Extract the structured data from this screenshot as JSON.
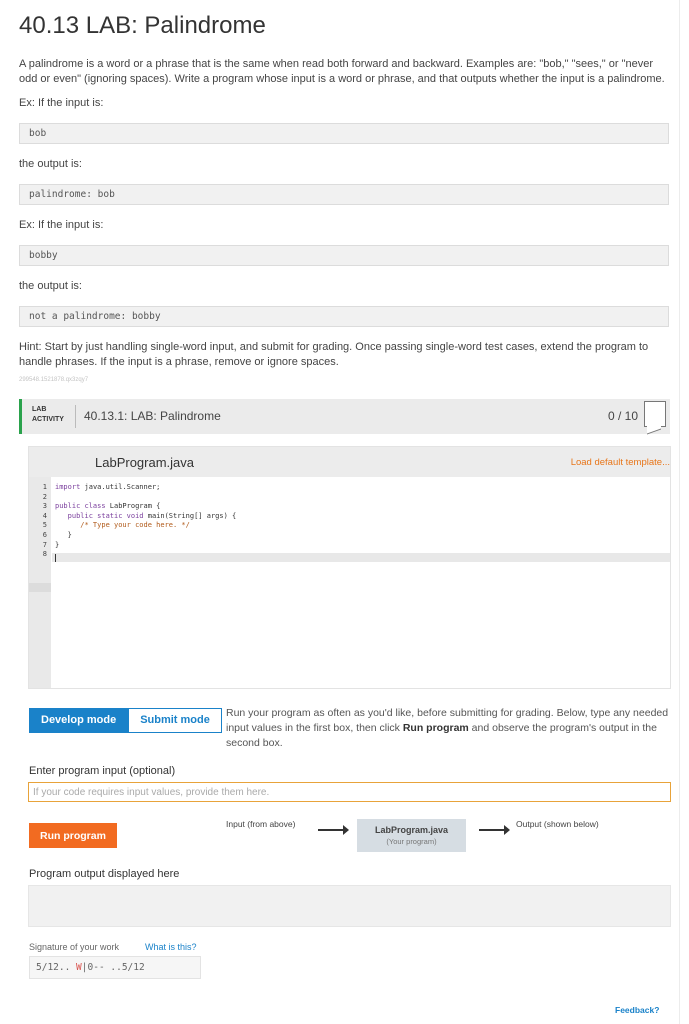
{
  "page": {
    "title": "40.13 LAB: Palindrome",
    "description": "A palindrome is a word or a phrase that is the same when read both forward and backward. Examples are: \"bob,\" \"sees,\" or \"never odd or even\" (ignoring spaces). Write a program whose input is a word or phrase, and that outputs whether the input is a palindrome.",
    "ex1_label": "Ex: If the input is:",
    "ex1_input": "bob",
    "out1_label": "the output is:",
    "ex1_output": "palindrome: bob",
    "ex2_label": "Ex: If the input is:",
    "ex2_input": "bobby",
    "out2_label": "the output is:",
    "ex2_output": "not a palindrome: bobby",
    "hint": "Hint: Start by just handling single-word input, and submit for grading. Once passing single-word test cases, extend the program to handle phrases. If the input is a phrase, remove or ignore spaces.",
    "tiny_id": "299548.1521878.qx3zqy7"
  },
  "lab": {
    "tag_line1": "LAB",
    "tag_line2": "ACTIVITY",
    "name": "40.13.1: LAB: Palindrome",
    "score": "0 / 10"
  },
  "editor": {
    "file_name": "LabProgram.java",
    "load_default": "Load default template...",
    "line_numbers": [
      "1",
      "2",
      "3",
      "4",
      "5",
      "6",
      "7",
      "8"
    ],
    "code": {
      "l1_kw": "import",
      "l1_rest": " java.util.Scanner;",
      "l3_kw": "public class",
      "l3_rest": " LabProgram {",
      "l4_kw": "   public static void",
      "l4_rest": " main(String[] args) {",
      "l5_cm": "      /* Type your code here. */",
      "l6": "   }",
      "l7": "}"
    }
  },
  "modes": {
    "develop": "Develop mode",
    "submit": "Submit mode",
    "desc_part1": "Run your program as often as you'd like, before submitting for grading. Below, type any needed input values in the first box, then click ",
    "desc_bold": "Run program",
    "desc_part2": " and observe the program's output in the second box."
  },
  "input": {
    "label": "Enter program input (optional)",
    "placeholder": "If your code requires input values, provide them here."
  },
  "run": {
    "button": "Run program",
    "flow_input": "Input (from above)",
    "flow_box_title": "LabProgram.java",
    "flow_box_sub": "(Your program)",
    "flow_output": "Output (shown below)"
  },
  "output": {
    "label": "Program output displayed here"
  },
  "signature": {
    "label": "Signature of your work",
    "link": "What is this?",
    "part1": "5/12.. ",
    "part2": "W",
    "part3": "|0-- ..5/12"
  },
  "footer": {
    "feedback": "Feedback?"
  }
}
